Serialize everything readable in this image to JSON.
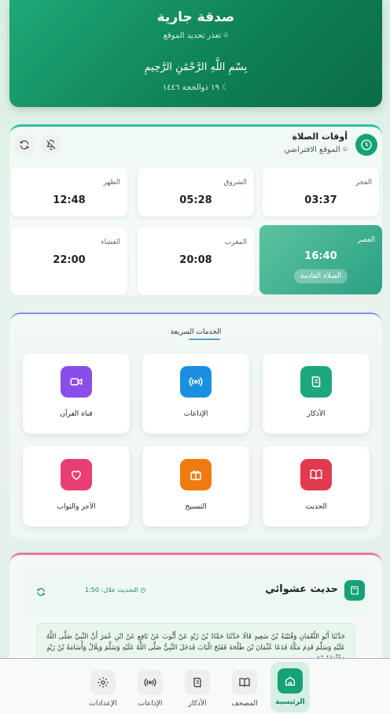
{
  "header": {
    "title": "صدقة جارية",
    "location_status": "تعذر تحديد الموقع",
    "basmala": "بِسْمِ اللَّهِ الرَّحْمَٰنِ الرَّحِيمِ",
    "hijri_date": "١٩ ذوالحجة ١٤٤٦"
  },
  "prayer": {
    "title": "أوقات الصلاة",
    "location": "الموقع الافتراضي",
    "times": [
      {
        "name": "الفجر",
        "time": "03:37"
      },
      {
        "name": "الشروق",
        "time": "05:28"
      },
      {
        "name": "الظهر",
        "time": "12:48"
      },
      {
        "name": "العصر",
        "time": "16:40"
      },
      {
        "name": "المغرب",
        "time": "20:08"
      },
      {
        "name": "العشاء",
        "time": "22:00"
      }
    ],
    "next_badge": "الصلاة القادمة"
  },
  "services": {
    "title": "الخدمات السريعة",
    "items": [
      {
        "label": "الأذكار",
        "icon": "adhkar-icon",
        "color": "#1ea77c"
      },
      {
        "label": "الإذاعات",
        "icon": "radio-icon",
        "color": "#1a8fe0"
      },
      {
        "label": "قناة القرآن",
        "icon": "video-icon",
        "color": "#8a4ee8"
      },
      {
        "label": "الحديث",
        "icon": "book-icon",
        "color": "#e23a4d"
      },
      {
        "label": "التسبيح",
        "icon": "gift-icon",
        "color": "#ef7a10"
      },
      {
        "label": "الأجر والثواب",
        "icon": "heart-icon",
        "color": "#e83e72"
      }
    ]
  },
  "hadith": {
    "title": "حديث عشوائي",
    "update_text": "التحديث خلال: 1:50",
    "text": "حَدَّثَنَا أَبُو النُّعْمَانِ وَقُتَيْبَةُ بْنُ سَعِيدٍ قَالَا حَدَّثَنَا حَمَّادُ بْنُ زَيْدٍ عَنْ أَيُّوبَ عَنْ نَافِعٍ عَنْ ابْنِ عُمَرَ أَنَّ النَّبِيَّ صَلَّى اللَّهُ عَلَيْهِ وَسَلَّمَ قَدِمَ مَكَّةَ فَدَعَا عُثْمَانَ بْنَ طَلْحَةَ فَفَتَحَ الْبَابَ فَدَخَلَ النَّبِيُّ صَلَّى اللَّهُ عَلَيْهِ وَسَلَّمَ وَبِلَالٌ وَأُسَامَةُ بْنُ زَيْدٍ وَعُثْمَانُ بْنُ"
  },
  "nav": {
    "items": [
      {
        "label": "الرئيسية",
        "icon": "home-icon"
      },
      {
        "label": "المصحف",
        "icon": "book-icon"
      },
      {
        "label": "الأذكار",
        "icon": "adhkar-icon"
      },
      {
        "label": "الإذاعات",
        "icon": "radio-icon"
      },
      {
        "label": "الإعدادات",
        "icon": "gear-icon"
      }
    ]
  }
}
